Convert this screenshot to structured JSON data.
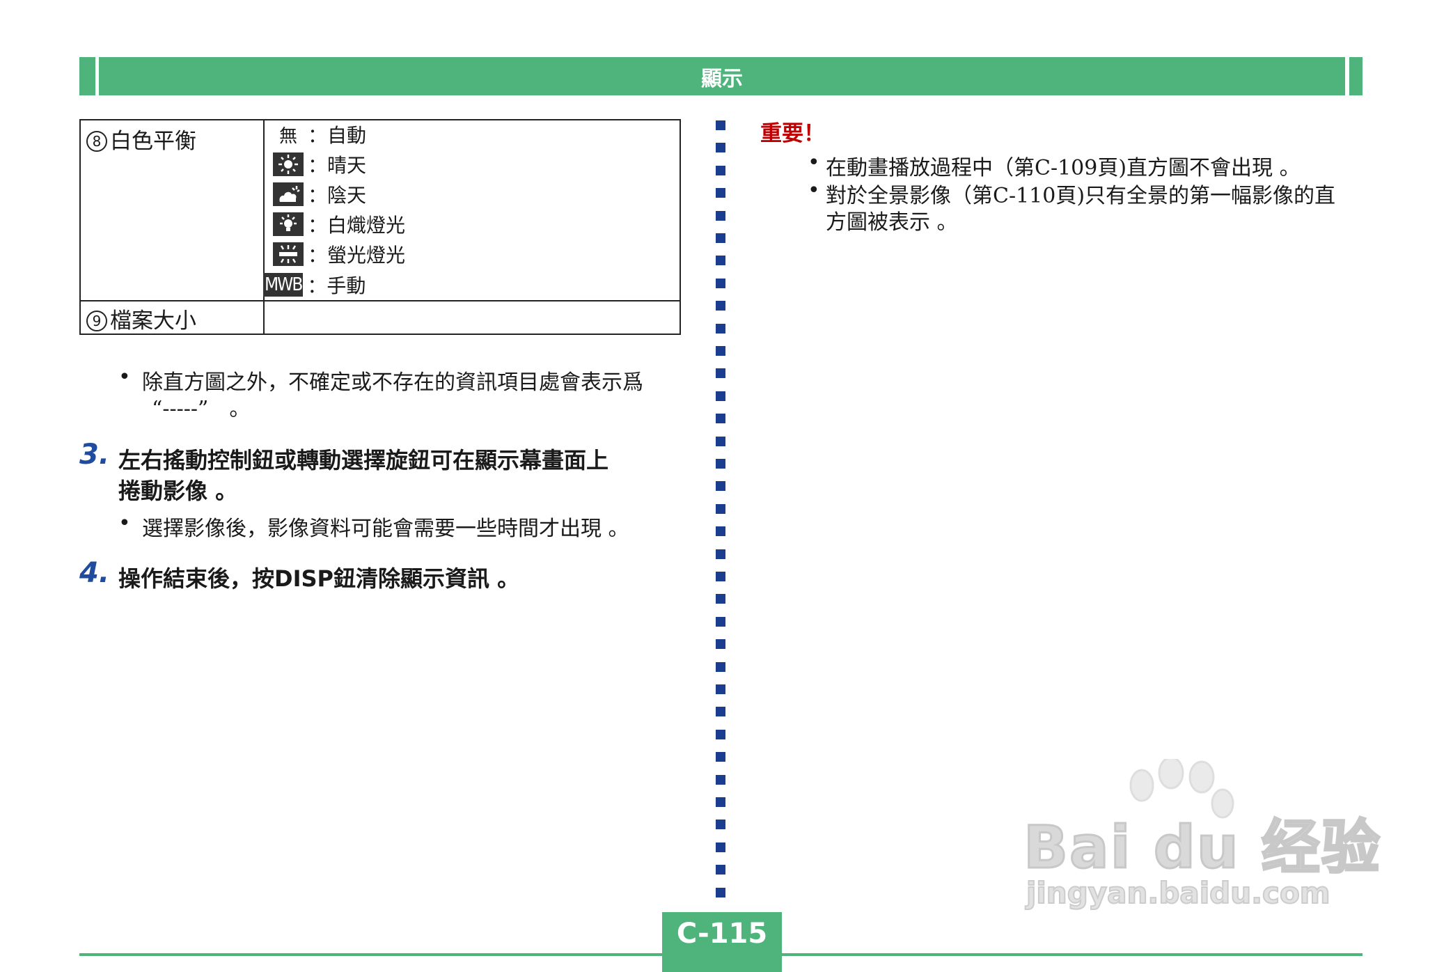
{
  "header": {
    "title": "顯示"
  },
  "table": {
    "rows": [
      {
        "number": "⑧",
        "label": "白色平衡",
        "options": [
          {
            "icon": "none-text",
            "icon_text": "無",
            "text": "：自動"
          },
          {
            "icon": "sun-icon",
            "text": "：晴天"
          },
          {
            "icon": "cloud-icon",
            "text": "：陰天"
          },
          {
            "icon": "bulb-icon",
            "text": "：白熾燈光"
          },
          {
            "icon": "fluorescent-icon",
            "text": "：螢光燈光"
          },
          {
            "icon": "mwb-icon",
            "icon_text": "MWB",
            "text": "：手動"
          }
        ]
      },
      {
        "number": "⑨",
        "label": "檔案大小",
        "options": []
      }
    ]
  },
  "left": {
    "note1_line1": "除直方圖之外，不確定或不存在的資訊項目處會表示爲",
    "note1_line2": "“-----”　。",
    "step3": {
      "number": "3.",
      "line1": "左右搖動控制鈕或轉動選擇旋鈕可在顯示幕畫面上",
      "line2": "捲動影像 。",
      "bullet": "選擇影像後，影像資料可能會需要一些時間才出現 。"
    },
    "step4": {
      "number": "4.",
      "text": "操作結束後，按DISP鈕清除顯示資訊 。"
    }
  },
  "right": {
    "heading": "重要！",
    "notes": [
      {
        "line1": "在動畫播放過程中（第C-109頁)直方圖不會出現 。"
      },
      {
        "line1": "對於全景影像（第C-110頁)只有全景的第一幅影像的直",
        "line2": "方圖被表示 。"
      }
    ]
  },
  "footer": {
    "page_number": "C-115"
  },
  "watermark": {
    "logo_text": "Bai du 经验",
    "url": "jingyan.baidu.com"
  },
  "colors": {
    "header_green": "#4fb47c",
    "step_blue": "#1f4c9e",
    "divider_blue": "#1a3d8f",
    "important_red": "#c00000"
  }
}
